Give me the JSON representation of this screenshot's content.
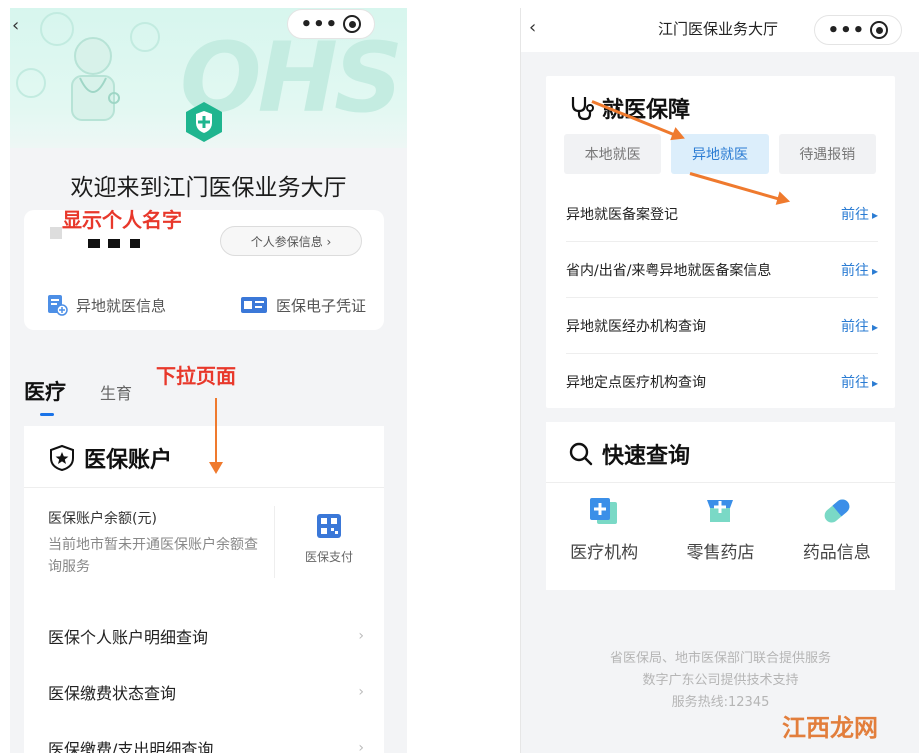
{
  "left": {
    "hero_deco_text": "OHS",
    "welcome": "欢迎来到江门医保业务大厅",
    "annotation_name": "显示个人名字",
    "insured_info_button": "个人参保信息 ›",
    "links": [
      "异地就医信息",
      "医保电子凭证"
    ],
    "annotation_scroll": "下拉页面",
    "tabs": [
      "医疗",
      "生育"
    ],
    "account": {
      "title": "医保账户",
      "balance_title": "医保账户余额(元)",
      "balance_note": "当前地市暂未开通医保账户余额查询服务",
      "pay_label": "医保支付",
      "rows": [
        "医保个人账户明细查询",
        "医保缴费状态查询",
        "医保缴费/支出明细查询"
      ]
    }
  },
  "right": {
    "title": "江门医保业务大厅",
    "jiuyi": {
      "title": "就医保障",
      "tabs": [
        "本地就医",
        "异地就医",
        "待遇报销"
      ],
      "active_tab": "异地就医",
      "rows": [
        {
          "label": "异地就医备案登记",
          "action": "前往"
        },
        {
          "label": "省内/出省/来粤异地就医备案信息",
          "action": "前往"
        },
        {
          "label": "异地就医经办机构查询",
          "action": "前往"
        },
        {
          "label": "异地定点医疗机构查询",
          "action": "前往"
        }
      ]
    },
    "quick": {
      "title": "快速查询",
      "items": [
        "医疗机构",
        "零售药店",
        "药品信息"
      ]
    },
    "footer": [
      "省医保局、地市医保部门联合提供服务",
      "数字广东公司提供技术支持",
      "服务热线:12345"
    ]
  },
  "watermark": "江西龙网",
  "colors": {
    "accent_blue": "#2b7cd3",
    "annotation_red": "#e8382b",
    "arrow_orange": "#ef7a2e",
    "brand_green": "#1fb58f"
  }
}
